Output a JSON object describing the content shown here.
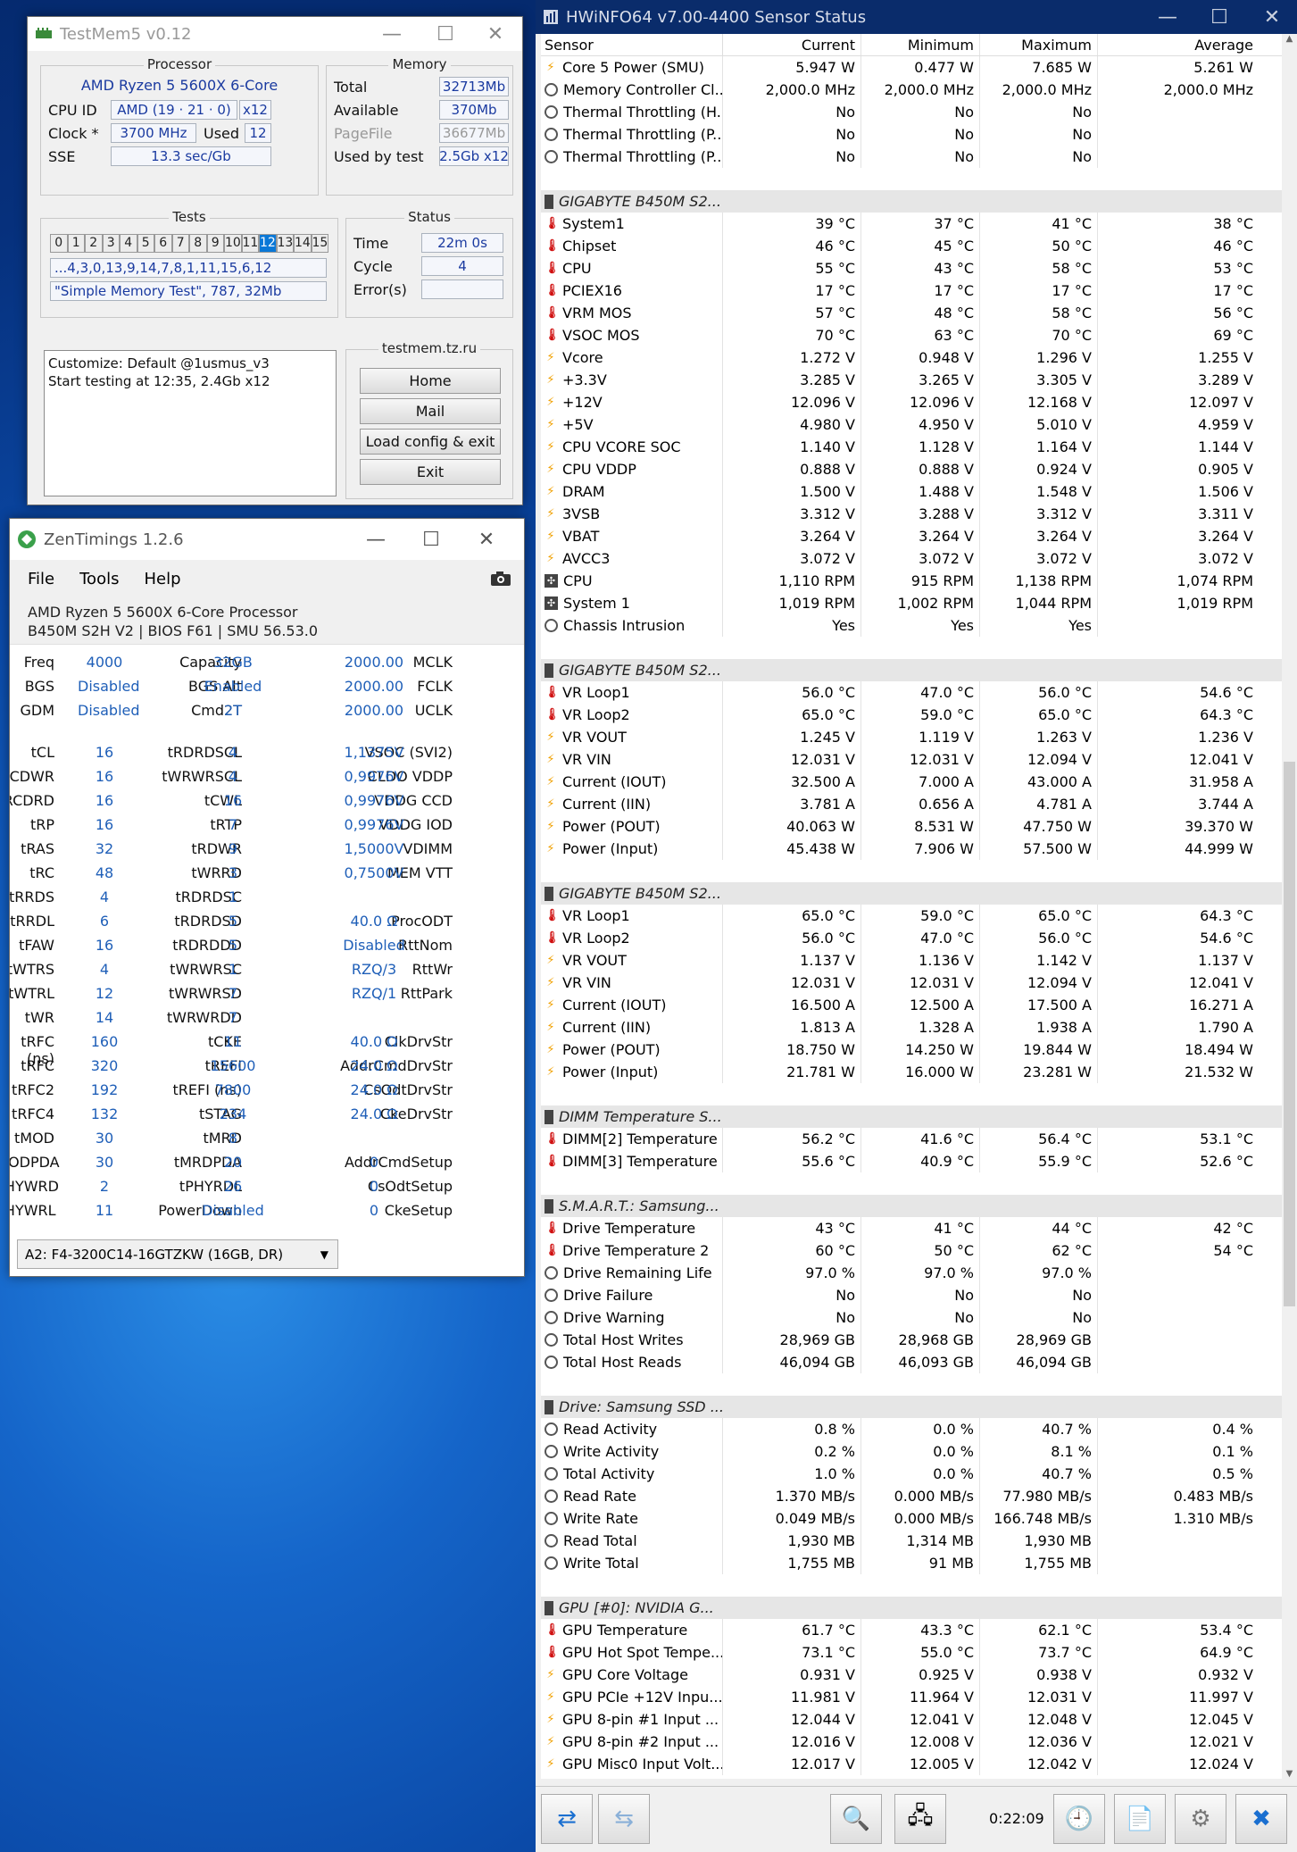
{
  "testmem5": {
    "title": "TestMem5 v0.12",
    "processor": {
      "label": "Processor",
      "name": "AMD Ryzen 5 5600X 6-Core",
      "cpu_id_label": "CPU ID",
      "cpu_id": "AMD  (19 · 21 · 0)",
      "threads": "x12",
      "clock_label": "Clock *",
      "clock": "3700 MHz",
      "used_label": "Used",
      "used": "12",
      "sse_label": "SSE",
      "sse": "13.3 sec/Gb"
    },
    "memory": {
      "label": "Memory",
      "total_label": "Total",
      "total": "32713Mb",
      "available_label": "Available",
      "available": "370Mb",
      "pagefile_label": "PageFile",
      "pagefile": "36677Mb",
      "used_by_test_label": "Used by test",
      "used_by_test": "2.5Gb x12"
    },
    "tests": {
      "label": "Tests",
      "cells": [
        "0",
        "1",
        "2",
        "3",
        "4",
        "5",
        "6",
        "7",
        "8",
        "9",
        "10",
        "11",
        "12",
        "13",
        "14",
        "15"
      ],
      "active": "12",
      "sequence": "...4,3,0,13,9,14,7,8,1,11,15,6,12",
      "current": "\"Simple Memory Test\", 787, 32Mb"
    },
    "status": {
      "label": "Status",
      "time_label": "Time",
      "time": "22m 0s",
      "cycle_label": "Cycle",
      "cycle": "4",
      "errors_label": "Error(s)",
      "errors": ""
    },
    "log": [
      "Customize: Default @1usmus_v3",
      "Start testing at 12:35, 2.4Gb x12"
    ],
    "site": "testmem.tz.ru",
    "buttons": {
      "home": "Home",
      "mail": "Mail",
      "load": "Load config & exit",
      "exit": "Exit"
    }
  },
  "zentimings": {
    "title": "ZenTimings 1.2.6",
    "menu": {
      "file": "File",
      "tools": "Tools",
      "help": "Help"
    },
    "cpu": "AMD Ryzen 5 5600X 6-Core Processor",
    "board": "B450M S2H V2 | BIOS F61 | SMU 56.53.0",
    "rows": [
      [
        [
          "Freq",
          "4000"
        ],
        [
          "Capacity",
          "32GB"
        ],
        [
          "MCLK",
          "2000.00"
        ]
      ],
      [
        [
          "BGS",
          "Disabled"
        ],
        [
          "BGS Alt",
          "Enabled"
        ],
        [
          "FCLK",
          "2000.00"
        ]
      ],
      [
        [
          "GDM",
          "Disabled"
        ],
        [
          "Cmd2T",
          "2T"
        ],
        [
          "UCLK",
          "2000.00"
        ]
      ],
      null,
      [
        [
          "tCL",
          "16"
        ],
        [
          "tRDRDSCL",
          "4"
        ],
        [
          "VSOC (SVI2)",
          "1,1375V"
        ]
      ],
      [
        [
          "tRCDWR",
          "16"
        ],
        [
          "tWRWRSCL",
          "4"
        ],
        [
          "CLDO VDDP",
          "0,9976V"
        ]
      ],
      [
        [
          "tRCDRD",
          "16"
        ],
        [
          "tCWL",
          "16"
        ],
        [
          "VDDG CCD",
          "0,9976V"
        ]
      ],
      [
        [
          "tRP",
          "16"
        ],
        [
          "tRTP",
          "7"
        ],
        [
          "VDDG IOD",
          "0,9976V"
        ]
      ],
      [
        [
          "tRAS",
          "32"
        ],
        [
          "tRDWR",
          "9"
        ],
        [
          "VDIMM",
          "1,5000V"
        ]
      ],
      [
        [
          "tRC",
          "48"
        ],
        [
          "tWRRD",
          "3"
        ],
        [
          "MEM VTT",
          "0,7500V"
        ]
      ],
      [
        [
          "tRRDS",
          "4"
        ],
        [
          "tRDRDSC",
          "1"
        ],
        [
          "",
          ""
        ]
      ],
      [
        [
          "tRRDL",
          "6"
        ],
        [
          "tRDRDSD",
          "5"
        ],
        [
          "ProcODT",
          "40.0 Ω"
        ]
      ],
      [
        [
          "tFAW",
          "16"
        ],
        [
          "tRDRDDD",
          "5"
        ],
        [
          "RttNom",
          "Disabled"
        ]
      ],
      [
        [
          "tWTRS",
          "4"
        ],
        [
          "tWRWRSC",
          "1"
        ],
        [
          "RttWr",
          "RZQ/3"
        ]
      ],
      [
        [
          "tWTRL",
          "12"
        ],
        [
          "tWRWRSD",
          "7"
        ],
        [
          "RttPark",
          "RZQ/1"
        ]
      ],
      [
        [
          "tWR",
          "14"
        ],
        [
          "tWRWRDD",
          "7"
        ],
        [
          "",
          ""
        ]
      ],
      [
        [
          "tRFC (ns)",
          "160"
        ],
        [
          "tCKE",
          "11"
        ],
        [
          "ClkDrvStr",
          "40.0 Ω"
        ]
      ],
      [
        [
          "tRFC",
          "320"
        ],
        [
          "tREFI",
          "15600"
        ],
        [
          "AddrCmdDrvStr",
          "24.0 Ω"
        ]
      ],
      [
        [
          "tRFC2",
          "192"
        ],
        [
          "tREFI (ns)",
          "7800"
        ],
        [
          "CsOdtDrvStr",
          "24.0 Ω"
        ]
      ],
      [
        [
          "tRFC4",
          "132"
        ],
        [
          "tSTAG",
          "234"
        ],
        [
          "CkeDrvStr",
          "24.0 Ω"
        ]
      ],
      [
        [
          "tMOD",
          "30"
        ],
        [
          "tMRD",
          "8"
        ],
        [
          "",
          ""
        ]
      ],
      [
        [
          "tMODPDA",
          "30"
        ],
        [
          "tMRDPDA",
          "20"
        ],
        [
          "AddrCmdSetup",
          "0"
        ]
      ],
      [
        [
          "tPHYWRD",
          "2"
        ],
        [
          "tPHYRDL",
          "26"
        ],
        [
          "CsOdtSetup",
          "0"
        ]
      ],
      [
        [
          "tPHYWRL",
          "11"
        ],
        [
          "PowerDown",
          "Disabled"
        ],
        [
          "CkeSetup",
          "0"
        ]
      ]
    ],
    "dimm_select": "A2: F4-3200C14-16GTZKW (16GB, DR)"
  },
  "hwinfo": {
    "title": "HWiNFO64 v7.00-4400 Sensor Status",
    "columns": [
      "Sensor",
      "Current",
      "Minimum",
      "Maximum",
      "Average"
    ],
    "rows": [
      {
        "i": "bolt",
        "n": "Core 5 Power (SMU)",
        "v": [
          "5.947 W",
          "0.477 W",
          "7.685 W",
          "5.261 W"
        ]
      },
      {
        "i": "circ",
        "n": "Memory Controller Cl...",
        "v": [
          "2,000.0 MHz",
          "2,000.0 MHz",
          "2,000.0 MHz",
          "2,000.0 MHz"
        ]
      },
      {
        "i": "circ",
        "n": "Thermal Throttling (H...",
        "v": [
          "No",
          "No",
          "No",
          ""
        ]
      },
      {
        "i": "circ",
        "n": "Thermal Throttling (P...",
        "v": [
          "No",
          "No",
          "No",
          ""
        ]
      },
      {
        "i": "circ",
        "n": "Thermal Throttling (P...",
        "v": [
          "No",
          "No",
          "No",
          ""
        ]
      },
      {
        "blank": true
      },
      {
        "g": "GIGABYTE B450M S2..."
      },
      {
        "i": "therm",
        "n": "System1",
        "v": [
          "39 °C",
          "37 °C",
          "41 °C",
          "38 °C"
        ]
      },
      {
        "i": "therm",
        "n": "Chipset",
        "v": [
          "46 °C",
          "45 °C",
          "50 °C",
          "46 °C"
        ]
      },
      {
        "i": "therm",
        "n": "CPU",
        "v": [
          "55 °C",
          "43 °C",
          "58 °C",
          "53 °C"
        ]
      },
      {
        "i": "therm",
        "n": "PCIEX16",
        "v": [
          "17 °C",
          "17 °C",
          "17 °C",
          "17 °C"
        ]
      },
      {
        "i": "therm",
        "n": "VRM MOS",
        "v": [
          "57 °C",
          "48 °C",
          "58 °C",
          "56 °C"
        ]
      },
      {
        "i": "therm",
        "n": "VSOC MOS",
        "v": [
          "70 °C",
          "63 °C",
          "70 °C",
          "69 °C"
        ]
      },
      {
        "i": "bolt",
        "n": "Vcore",
        "v": [
          "1.272 V",
          "0.948 V",
          "1.296 V",
          "1.255 V"
        ]
      },
      {
        "i": "bolt",
        "n": "+3.3V",
        "v": [
          "3.285 V",
          "3.265 V",
          "3.305 V",
          "3.289 V"
        ]
      },
      {
        "i": "bolt",
        "n": "+12V",
        "v": [
          "12.096 V",
          "12.096 V",
          "12.168 V",
          "12.097 V"
        ]
      },
      {
        "i": "bolt",
        "n": "+5V",
        "v": [
          "4.980 V",
          "4.950 V",
          "5.010 V",
          "4.959 V"
        ]
      },
      {
        "i": "bolt",
        "n": "CPU VCORE SOC",
        "v": [
          "1.140 V",
          "1.128 V",
          "1.164 V",
          "1.144 V"
        ]
      },
      {
        "i": "bolt",
        "n": "CPU VDDP",
        "v": [
          "0.888 V",
          "0.888 V",
          "0.924 V",
          "0.905 V"
        ]
      },
      {
        "i": "bolt",
        "n": "DRAM",
        "v": [
          "1.500 V",
          "1.488 V",
          "1.548 V",
          "1.506 V"
        ]
      },
      {
        "i": "bolt",
        "n": "3VSB",
        "v": [
          "3.312 V",
          "3.288 V",
          "3.312 V",
          "3.311 V"
        ]
      },
      {
        "i": "bolt",
        "n": "VBAT",
        "v": [
          "3.264 V",
          "3.264 V",
          "3.264 V",
          "3.264 V"
        ]
      },
      {
        "i": "bolt",
        "n": "AVCC3",
        "v": [
          "3.072 V",
          "3.072 V",
          "3.072 V",
          "3.072 V"
        ]
      },
      {
        "i": "fan",
        "n": "CPU",
        "v": [
          "1,110 RPM",
          "915 RPM",
          "1,138 RPM",
          "1,074 RPM"
        ]
      },
      {
        "i": "fan",
        "n": "System 1",
        "v": [
          "1,019 RPM",
          "1,002 RPM",
          "1,044 RPM",
          "1,019 RPM"
        ]
      },
      {
        "i": "circ",
        "n": "Chassis Intrusion",
        "v": [
          "Yes",
          "Yes",
          "Yes",
          ""
        ]
      },
      {
        "blank": true
      },
      {
        "g": "GIGABYTE B450M S2..."
      },
      {
        "i": "therm",
        "n": "VR Loop1",
        "v": [
          "56.0 °C",
          "47.0 °C",
          "56.0 °C",
          "54.6 °C"
        ]
      },
      {
        "i": "therm",
        "n": "VR Loop2",
        "v": [
          "65.0 °C",
          "59.0 °C",
          "65.0 °C",
          "64.3 °C"
        ]
      },
      {
        "i": "bolt",
        "n": "VR VOUT",
        "v": [
          "1.245 V",
          "1.119 V",
          "1.263 V",
          "1.236 V"
        ]
      },
      {
        "i": "bolt",
        "n": "VR VIN",
        "v": [
          "12.031 V",
          "12.031 V",
          "12.094 V",
          "12.041 V"
        ]
      },
      {
        "i": "bolt",
        "n": "Current (IOUT)",
        "v": [
          "32.500 A",
          "7.000 A",
          "43.000 A",
          "31.958 A"
        ]
      },
      {
        "i": "bolt",
        "n": "Current (IIN)",
        "v": [
          "3.781 A",
          "0.656 A",
          "4.781 A",
          "3.744 A"
        ]
      },
      {
        "i": "bolt",
        "n": "Power (POUT)",
        "v": [
          "40.063 W",
          "8.531 W",
          "47.750 W",
          "39.370 W"
        ]
      },
      {
        "i": "bolt",
        "n": "Power (Input)",
        "v": [
          "45.438 W",
          "7.906 W",
          "57.500 W",
          "44.999 W"
        ]
      },
      {
        "blank": true
      },
      {
        "g": "GIGABYTE B450M S2..."
      },
      {
        "i": "therm",
        "n": "VR Loop1",
        "v": [
          "65.0 °C",
          "59.0 °C",
          "65.0 °C",
          "64.3 °C"
        ]
      },
      {
        "i": "therm",
        "n": "VR Loop2",
        "v": [
          "56.0 °C",
          "47.0 °C",
          "56.0 °C",
          "54.6 °C"
        ]
      },
      {
        "i": "bolt",
        "n": "VR VOUT",
        "v": [
          "1.137 V",
          "1.136 V",
          "1.142 V",
          "1.137 V"
        ]
      },
      {
        "i": "bolt",
        "n": "VR VIN",
        "v": [
          "12.031 V",
          "12.031 V",
          "12.094 V",
          "12.041 V"
        ]
      },
      {
        "i": "bolt",
        "n": "Current (IOUT)",
        "v": [
          "16.500 A",
          "12.500 A",
          "17.500 A",
          "16.271 A"
        ]
      },
      {
        "i": "bolt",
        "n": "Current (IIN)",
        "v": [
          "1.813 A",
          "1.328 A",
          "1.938 A",
          "1.790 A"
        ]
      },
      {
        "i": "bolt",
        "n": "Power (POUT)",
        "v": [
          "18.750 W",
          "14.250 W",
          "19.844 W",
          "18.494 W"
        ]
      },
      {
        "i": "bolt",
        "n": "Power (Input)",
        "v": [
          "21.781 W",
          "16.000 W",
          "23.281 W",
          "21.532 W"
        ]
      },
      {
        "blank": true
      },
      {
        "g": "DIMM Temperature S..."
      },
      {
        "i": "therm",
        "n": "DIMM[2] Temperature",
        "v": [
          "56.2 °C",
          "41.6 °C",
          "56.4 °C",
          "53.1 °C"
        ]
      },
      {
        "i": "therm",
        "n": "DIMM[3] Temperature",
        "v": [
          "55.6 °C",
          "40.9 °C",
          "55.9 °C",
          "52.6 °C"
        ]
      },
      {
        "blank": true
      },
      {
        "g": "S.M.A.R.T.: Samsung..."
      },
      {
        "i": "therm",
        "n": "Drive Temperature",
        "v": [
          "43 °C",
          "41 °C",
          "44 °C",
          "42 °C"
        ]
      },
      {
        "i": "therm",
        "n": "Drive Temperature 2",
        "v": [
          "60 °C",
          "50 °C",
          "62 °C",
          "54 °C"
        ]
      },
      {
        "i": "circ",
        "n": "Drive Remaining Life",
        "v": [
          "97.0 %",
          "97.0 %",
          "97.0 %",
          ""
        ]
      },
      {
        "i": "circ",
        "n": "Drive Failure",
        "v": [
          "No",
          "No",
          "No",
          ""
        ]
      },
      {
        "i": "circ",
        "n": "Drive Warning",
        "v": [
          "No",
          "No",
          "No",
          ""
        ]
      },
      {
        "i": "circ",
        "n": "Total Host Writes",
        "v": [
          "28,969 GB",
          "28,968 GB",
          "28,969 GB",
          ""
        ]
      },
      {
        "i": "circ",
        "n": "Total Host Reads",
        "v": [
          "46,094 GB",
          "46,093 GB",
          "46,094 GB",
          ""
        ]
      },
      {
        "blank": true
      },
      {
        "g": "Drive: Samsung SSD ..."
      },
      {
        "i": "circ",
        "n": "Read Activity",
        "v": [
          "0.8 %",
          "0.0 %",
          "40.7 %",
          "0.4 %"
        ]
      },
      {
        "i": "circ",
        "n": "Write Activity",
        "v": [
          "0.2 %",
          "0.0 %",
          "8.1 %",
          "0.1 %"
        ]
      },
      {
        "i": "circ",
        "n": "Total Activity",
        "v": [
          "1.0 %",
          "0.0 %",
          "40.7 %",
          "0.5 %"
        ]
      },
      {
        "i": "circ",
        "n": "Read Rate",
        "v": [
          "1.370 MB/s",
          "0.000 MB/s",
          "77.980 MB/s",
          "0.483 MB/s"
        ]
      },
      {
        "i": "circ",
        "n": "Write Rate",
        "v": [
          "0.049 MB/s",
          "0.000 MB/s",
          "166.748 MB/s",
          "1.310 MB/s"
        ]
      },
      {
        "i": "circ",
        "n": "Read Total",
        "v": [
          "1,930 MB",
          "1,314 MB",
          "1,930 MB",
          ""
        ]
      },
      {
        "i": "circ",
        "n": "Write Total",
        "v": [
          "1,755 MB",
          "91 MB",
          "1,755 MB",
          ""
        ]
      },
      {
        "blank": true
      },
      {
        "g": "GPU [#0]: NVIDIA G..."
      },
      {
        "i": "therm",
        "n": "GPU Temperature",
        "v": [
          "61.7 °C",
          "43.3 °C",
          "62.1 °C",
          "53.4 °C"
        ]
      },
      {
        "i": "therm",
        "n": "GPU Hot Spot Tempe...",
        "v": [
          "73.1 °C",
          "55.0 °C",
          "73.7 °C",
          "64.9 °C"
        ]
      },
      {
        "i": "bolt",
        "n": "GPU Core Voltage",
        "v": [
          "0.931 V",
          "0.925 V",
          "0.938 V",
          "0.932 V"
        ]
      },
      {
        "i": "bolt",
        "n": "GPU PCIe +12V Inpu...",
        "v": [
          "11.981 V",
          "11.964 V",
          "12.031 V",
          "11.997 V"
        ]
      },
      {
        "i": "bolt",
        "n": "GPU 8-pin #1 Input ...",
        "v": [
          "12.044 V",
          "12.041 V",
          "12.048 V",
          "12.045 V"
        ]
      },
      {
        "i": "bolt",
        "n": "GPU 8-pin #2 Input ...",
        "v": [
          "12.016 V",
          "12.008 V",
          "12.036 V",
          "12.021 V"
        ]
      },
      {
        "i": "bolt",
        "n": "GPU Misc0 Input Volt...",
        "v": [
          "12.017 V",
          "12.005 V",
          "12.042 V",
          "12.024 V"
        ]
      }
    ],
    "timer": "0:22:09"
  }
}
